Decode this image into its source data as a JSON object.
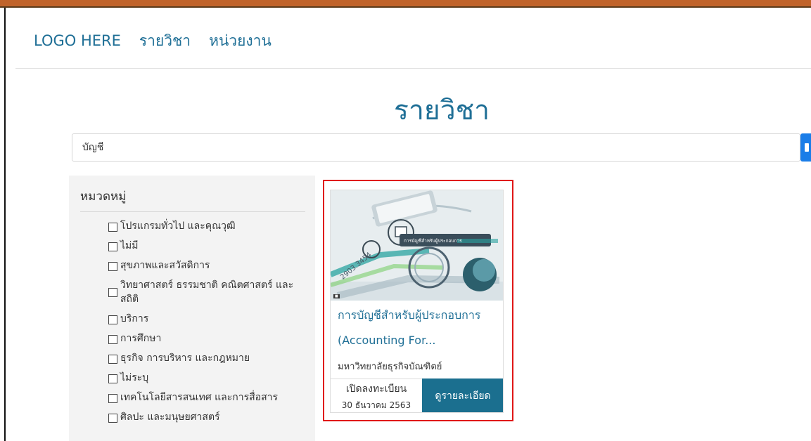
{
  "navbar": {
    "logo": "LOGO HERE",
    "links": [
      "รายวิชา",
      "หน่วยงาน"
    ]
  },
  "page": {
    "title": "รายวิชา"
  },
  "search": {
    "value": "บัญชี",
    "placeholder": ""
  },
  "filters": {
    "title": "หมวดหมู่",
    "items": [
      "โปรแกรมทั่วไป และคุณวุฒิ",
      "ไม่มี",
      "สุขภาพและสวัสดิการ",
      "วิทยาศาสตร์ ธรรมชาติ คณิตศาสตร์ และสถิติ",
      "บริการ",
      "การศึกษา",
      "ธุรกิจ การบริหาร และกฎหมาย",
      "ไม่ระบุ",
      "เทคโนโลยีสารสนเทศ และการสื่อสาร",
      "ศิลปะ และมนุษยศาสตร์"
    ]
  },
  "course": {
    "title": "การบัญชีสำหรับผู้ประกอบการ (Accounting For...",
    "university": "มหาวิทยาลัยธุรกิจบัณฑิตย์",
    "registration_label": "เปิดลงทะเบียน",
    "registration_date": "30 ธันวาคม 2563",
    "details_button": "ดูรายละเอียด",
    "image_caption": "การบัญชีสำหรับผู้ประกอบการ",
    "image_number": "2903.3454"
  },
  "colors": {
    "accent": "#1f6f96",
    "details_button": "#1b6f8f",
    "highlight": "#e01616",
    "search_button": "#1a7de8"
  }
}
